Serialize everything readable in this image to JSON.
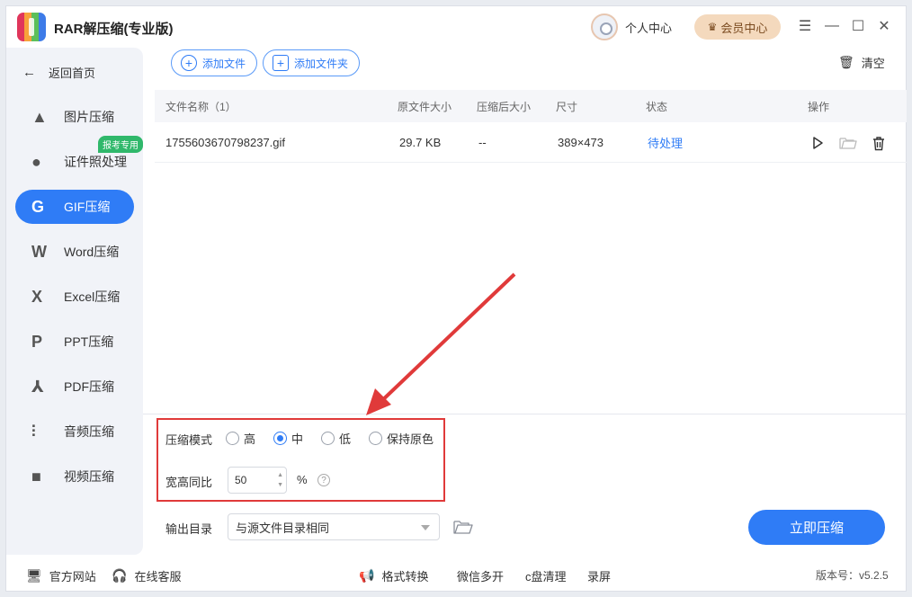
{
  "app": {
    "title": "RAR解压缩(专业版)",
    "accent": "#2f7cf6"
  },
  "header": {
    "profile_label": "个人中心",
    "vip_label": "会员中心"
  },
  "sidebar": {
    "back_label": "返回首页",
    "badge": "报考专用",
    "items": [
      {
        "label": "图片压缩",
        "icon": "image-icon"
      },
      {
        "label": "证件照处理",
        "icon": "id-photo-icon"
      },
      {
        "label": "GIF压缩",
        "icon": "gif-icon",
        "active": true
      },
      {
        "label": "Word压缩",
        "icon": "word-icon"
      },
      {
        "label": "Excel压缩",
        "icon": "excel-icon"
      },
      {
        "label": "PPT压缩",
        "icon": "ppt-icon"
      },
      {
        "label": "PDF压缩",
        "icon": "pdf-icon"
      },
      {
        "label": "音频压缩",
        "icon": "audio-icon"
      },
      {
        "label": "视频压缩",
        "icon": "video-icon"
      }
    ]
  },
  "toolbar": {
    "add_file": "添加文件",
    "add_folder": "添加文件夹",
    "clear": "清空"
  },
  "table": {
    "headers": [
      "文件名称（1）",
      "原文件大小",
      "压缩后大小",
      "尺寸",
      "状态",
      "操作"
    ],
    "rows": [
      {
        "name": "1755603670798237.gif",
        "orig_size": "29.7 KB",
        "comp_size": "--",
        "dimensions": "389×473",
        "status": "待处理"
      }
    ]
  },
  "settings": {
    "mode_label": "压缩模式",
    "modes": [
      "高",
      "中",
      "低",
      "保持原色"
    ],
    "selected_mode": "中",
    "ratio_label": "宽高同比",
    "ratio_value": "50",
    "ratio_unit": "%",
    "help": "?",
    "output_label": "输出目录",
    "output_value": "与源文件目录相同",
    "start_button": "立即压缩"
  },
  "footer": {
    "website": "官方网站",
    "support": "在线客服",
    "convert": "格式转换",
    "wechat": "微信多开",
    "cleanup": "c盘清理",
    "record": "录屏",
    "version": "版本号：v5.2.5"
  }
}
